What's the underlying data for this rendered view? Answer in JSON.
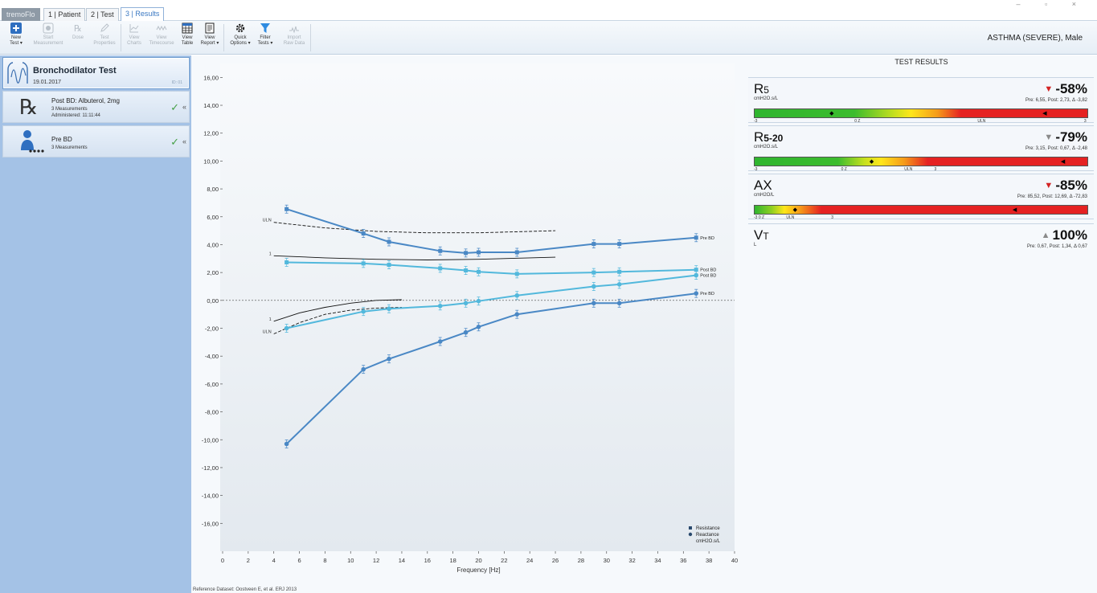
{
  "tabs": [
    {
      "label": "tremoFlo"
    },
    {
      "label": "1 | Patient"
    },
    {
      "label": "2 | Test"
    },
    {
      "label": "3 | Results"
    }
  ],
  "window_controls": "– ▫ ×",
  "toolbar": {
    "buttons": [
      {
        "label1": "New",
        "label2": "Test ▾",
        "icon": "plus-icon"
      },
      {
        "label1": "Start",
        "label2": "Measurement",
        "icon": "record-icon"
      },
      {
        "label1": "Dose",
        "label2": "",
        "icon": "rx-icon"
      },
      {
        "label1": "Test",
        "label2": "Properties",
        "icon": "pencil-icon"
      },
      {
        "label1": "View",
        "label2": "Charts",
        "icon": "chart-icon"
      },
      {
        "label1": "View",
        "label2": "Timecourse",
        "icon": "timecourse-icon"
      },
      {
        "label1": "View",
        "label2": "Table",
        "icon": "table-icon"
      },
      {
        "label1": "View",
        "label2": "Report ▾",
        "icon": "report-icon"
      },
      {
        "label1": "Quick",
        "label2": "Options ▾",
        "icon": "gear-icon"
      },
      {
        "label1": "Filter",
        "label2": "Tests ▾",
        "icon": "filter-icon"
      },
      {
        "label1": "Import",
        "label2": "Raw Data",
        "icon": "import-icon"
      }
    ],
    "patient_info": "ASTHMA (SEVERE), Male"
  },
  "left_panel": {
    "test_card": {
      "title": "Bronchodilator Test",
      "date": "19.01.2017",
      "tag": "ID: 01"
    },
    "post_bd": {
      "title": "Post BD: Albuterol, 2mg",
      "measurements": "3 Measurements",
      "administered": "Administered: 11:11:44",
      "check": "✓",
      "collapse": "«"
    },
    "pre_bd": {
      "title": "Pre BD",
      "measurements": "3 Measurements",
      "check": "✓",
      "collapse": "«"
    }
  },
  "chart_data": {
    "type": "line",
    "xlabel": "Frequency [Hz]",
    "xlim": [
      0,
      40
    ],
    "ylim": [
      -18,
      17
    ],
    "xticks": [
      0,
      2,
      4,
      6,
      8,
      10,
      12,
      14,
      16,
      18,
      20,
      22,
      24,
      26,
      28,
      30,
      32,
      34,
      36,
      38,
      40
    ],
    "yticks": [
      "16,00",
      "14,00",
      "12,00",
      "10,00",
      "8,00",
      "6,00",
      "4,00",
      "2,00",
      "0,00",
      "-2,00",
      "-4,00",
      "-6,00",
      "-8,00",
      "-10,00",
      "-12,00",
      "-14,00",
      "-16,00"
    ],
    "yvals": [
      16,
      14,
      12,
      10,
      8,
      6,
      4,
      2,
      0,
      -2,
      -4,
      -6,
      -8,
      -10,
      -12,
      -14,
      -16
    ],
    "series": [
      {
        "name": "Pre BD",
        "kind": "Resistance",
        "color": "#4a88c5",
        "x": [
          5,
          11,
          13,
          17,
          19,
          20,
          23,
          29,
          31,
          37
        ],
        "y": [
          6.55,
          4.8,
          4.2,
          3.55,
          3.4,
          3.45,
          3.45,
          4.05,
          4.05,
          4.5
        ]
      },
      {
        "name": "Post BD",
        "kind": "Resistance",
        "color": "#52b8dc",
        "x": [
          5,
          11,
          13,
          17,
          19,
          20,
          23,
          29,
          31,
          37
        ],
        "y": [
          2.73,
          2.65,
          2.55,
          2.3,
          2.15,
          2.05,
          1.9,
          2.0,
          2.05,
          2.2
        ]
      },
      {
        "name": "Post BD",
        "kind": "Reactance",
        "color": "#52b8dc",
        "x": [
          5,
          11,
          13,
          17,
          19,
          20,
          23,
          29,
          31,
          37
        ],
        "y": [
          -2.0,
          -0.8,
          -0.6,
          -0.4,
          -0.2,
          -0.05,
          0.35,
          1.0,
          1.15,
          1.8
        ]
      },
      {
        "name": "Pre BD",
        "kind": "Reactance",
        "color": "#4a88c5",
        "x": [
          5,
          11,
          13,
          17,
          19,
          20,
          23,
          29,
          31,
          37
        ],
        "y": [
          -10.3,
          -4.95,
          -4.2,
          -2.95,
          -2.3,
          -1.9,
          -1.0,
          -0.2,
          -0.2,
          0.5
        ]
      }
    ],
    "reference_lines": [
      {
        "label": "ULN",
        "style": "dashed",
        "x": [
          4,
          8,
          12,
          16,
          20,
          24,
          26
        ],
        "y": [
          5.6,
          5.2,
          4.95,
          4.85,
          4.85,
          4.95,
          5.0
        ]
      },
      {
        "label": "1",
        "style": "solid",
        "x": [
          4,
          8,
          12,
          16,
          20,
          24,
          26
        ],
        "y": [
          3.2,
          3.05,
          2.95,
          2.9,
          2.95,
          3.05,
          3.1
        ]
      },
      {
        "label": "1",
        "style": "solid",
        "x": [
          4,
          6,
          8,
          10,
          12,
          14
        ],
        "y": [
          -1.5,
          -0.9,
          -0.5,
          -0.2,
          0.0,
          0.05
        ]
      },
      {
        "label": "ULN",
        "style": "dashed",
        "x": [
          4,
          6,
          8,
          10,
          12,
          14
        ],
        "y": [
          -2.4,
          -1.6,
          -1.0,
          -0.7,
          -0.55,
          -0.5
        ]
      }
    ],
    "legend": [
      {
        "label": "Resistance",
        "marker": "square"
      },
      {
        "label": "Reactance",
        "marker": "circle"
      },
      {
        "label": "cmH2O.s/L",
        "marker": ""
      }
    ],
    "legend_position": "bottom-right"
  },
  "footnote": "Reference Dataset: Oostveen E, et al. ERJ 2013",
  "results": {
    "title": "TEST RESULTS",
    "items": [
      {
        "name": "R",
        "sub": "5",
        "unit": "cmH2O.s/L",
        "arrow": "▼",
        "arrow_color": "#d32323",
        "pct": "-58%",
        "detail": "Pre: 6,55, Post: 2,73, Δ -3,82",
        "bar": "full",
        "ticks": [
          "-3",
          "0 Z",
          "ULN",
          "3"
        ],
        "markers": [
          {
            "sym": "◆",
            "fraction": 0.225
          },
          {
            "sym": "◀",
            "fraction": 0.865
          }
        ]
      },
      {
        "name": "R",
        "sub": "5-20",
        "unit": "cmH2O.s/L",
        "arrow": "▼",
        "arrow_color": "#8a8a8a",
        "pct": "-79%",
        "detail": "Pre: 3,15, Post: 0,67, Δ -2,48",
        "bar": "full",
        "ticks": [
          "-3",
          "0 Z",
          "ULN",
          "3"
        ],
        "markers": [
          {
            "sym": "◆",
            "fraction": 0.345
          },
          {
            "sym": "◀",
            "fraction": 0.92
          }
        ]
      },
      {
        "name": "AX",
        "sub": "",
        "unit": "cmH2O/L",
        "arrow": "▼",
        "arrow_color": "#d32323",
        "pct": "-85%",
        "detail": "Pre: 85,52, Post: 12,69, Δ -72,83",
        "bar": "full",
        "ticks": [
          "-3 0 Z",
          "ULN",
          "3"
        ],
        "markers": [
          {
            "sym": "◆",
            "fraction": 0.115
          },
          {
            "sym": "◀",
            "fraction": 0.775
          }
        ]
      },
      {
        "name": "V",
        "sub": "T",
        "unit": "L",
        "arrow": "▲",
        "arrow_color": "#8a8a8a",
        "pct": "100%",
        "detail": "Pre: 0,67, Post: 1,34, Δ 0,67",
        "bar": "none",
        "ticks": [],
        "markers": []
      }
    ]
  },
  "colors": {
    "accent": "#3a78c2",
    "pre_bd": "#4a88c5",
    "post_bd": "#52b8dc",
    "left_panel": "#a4c2e6",
    "bar_green": "#33b533",
    "bar_yellow": "#ffe61a",
    "bar_red": "#e52222"
  }
}
